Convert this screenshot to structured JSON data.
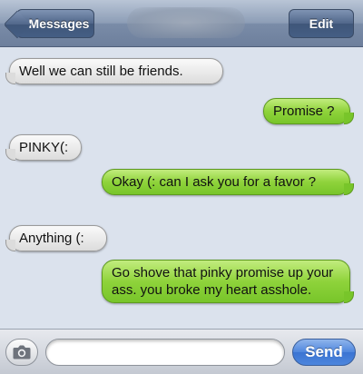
{
  "navbar": {
    "back_label": "Messages",
    "edit_label": "Edit"
  },
  "messages": [
    {
      "direction": "incoming",
      "text": "Well we can still be friends."
    },
    {
      "direction": "outgoing",
      "text": "Promise ?"
    },
    {
      "direction": "incoming",
      "text": "PINKY(:"
    },
    {
      "direction": "outgoing",
      "text": "Okay (: can I ask you for a favor ?"
    },
    {
      "direction": "incoming",
      "text": "Anything (:"
    },
    {
      "direction": "outgoing",
      "text": "Go shove that pinky promise up your ass. you broke my heart asshole."
    }
  ],
  "composer": {
    "input_value": "",
    "input_placeholder": "",
    "send_label": "Send",
    "camera_icon": "camera-icon"
  },
  "colors": {
    "navbar": "#7a8ca8",
    "background": "#dbe2ed",
    "incoming_bubble": "#e8e8e8",
    "outgoing_bubble": "#8fd33b",
    "send_button": "#4f86dd"
  }
}
